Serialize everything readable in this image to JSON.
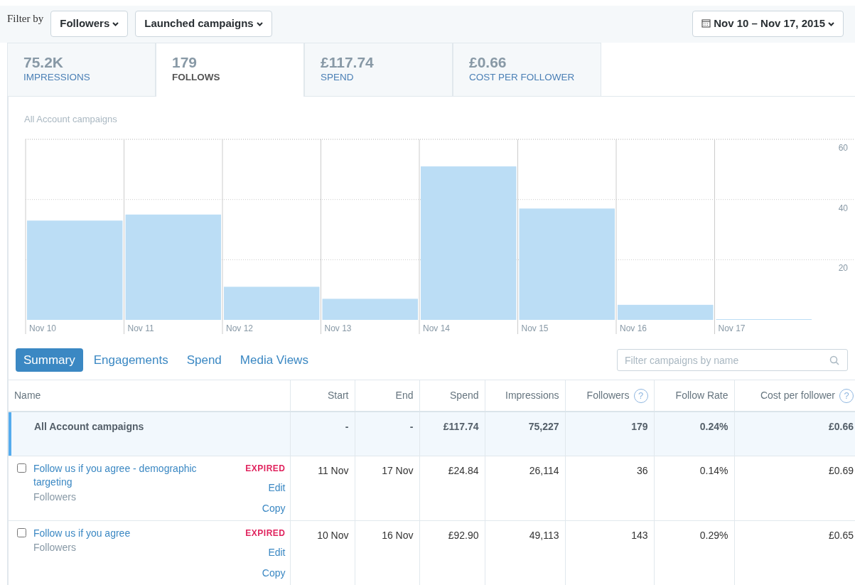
{
  "filter_bar": {
    "label": "Filter by",
    "dropdowns": [
      "Followers",
      "Launched campaigns"
    ],
    "date_range": "Nov 10 – Nov 17, 2015"
  },
  "metrics": [
    {
      "value": "75.2K",
      "label": "IMPRESSIONS",
      "selected": false
    },
    {
      "value": "179",
      "label": "FOLLOWS",
      "selected": true
    },
    {
      "value": "£117.74",
      "label": "SPEND",
      "selected": false
    },
    {
      "value": "£0.66",
      "label": "COST PER FOLLOWER",
      "selected": false
    }
  ],
  "chart": {
    "title": "All Account campaigns",
    "chart_data": {
      "type": "bar",
      "categories": [
        "Nov 10",
        "Nov 11",
        "Nov 12",
        "Nov 13",
        "Nov 14",
        "Nov 15",
        "Nov 16",
        "Nov 17"
      ],
      "values": [
        33,
        35,
        11,
        7,
        51,
        37,
        5,
        0
      ],
      "ylim": [
        0,
        60
      ],
      "yticks": [
        20,
        40,
        60
      ]
    }
  },
  "view_tabs": [
    {
      "label": "Summary",
      "selected": true
    },
    {
      "label": "Engagements",
      "selected": false
    },
    {
      "label": "Spend",
      "selected": false
    },
    {
      "label": "Media Views",
      "selected": false
    }
  ],
  "search": {
    "placeholder": "Filter campaigns by name"
  },
  "table": {
    "name_header": "Name",
    "columns": [
      {
        "label": "Start"
      },
      {
        "label": "End"
      },
      {
        "label": "Spend"
      },
      {
        "label": "Impressions"
      },
      {
        "label": "Followers",
        "help": "?"
      },
      {
        "label": "Follow Rate"
      },
      {
        "label": "Cost per follower",
        "help": "?"
      }
    ],
    "summary_row": {
      "name": "All Account campaigns",
      "cells": [
        "-",
        "-",
        "£117.74",
        "75,227",
        "179",
        "0.24%",
        "£0.66"
      ]
    },
    "rows": [
      {
        "checked": false,
        "name": "Follow us if you agree - demographic targeting",
        "objective": "Followers",
        "status": "EXPIRED",
        "actions": [
          "Edit",
          "Copy"
        ],
        "cells": [
          "11 Nov",
          "17 Nov",
          "£24.84",
          "26,114",
          "36",
          "0.14%",
          "£0.69"
        ]
      },
      {
        "checked": false,
        "name": "Follow us if you agree",
        "objective": "Followers",
        "status": "EXPIRED",
        "actions": [
          "Edit",
          "Copy"
        ],
        "cells": [
          "10 Nov",
          "16 Nov",
          "£92.90",
          "49,113",
          "143",
          "0.29%",
          "£0.65"
        ]
      }
    ]
  }
}
